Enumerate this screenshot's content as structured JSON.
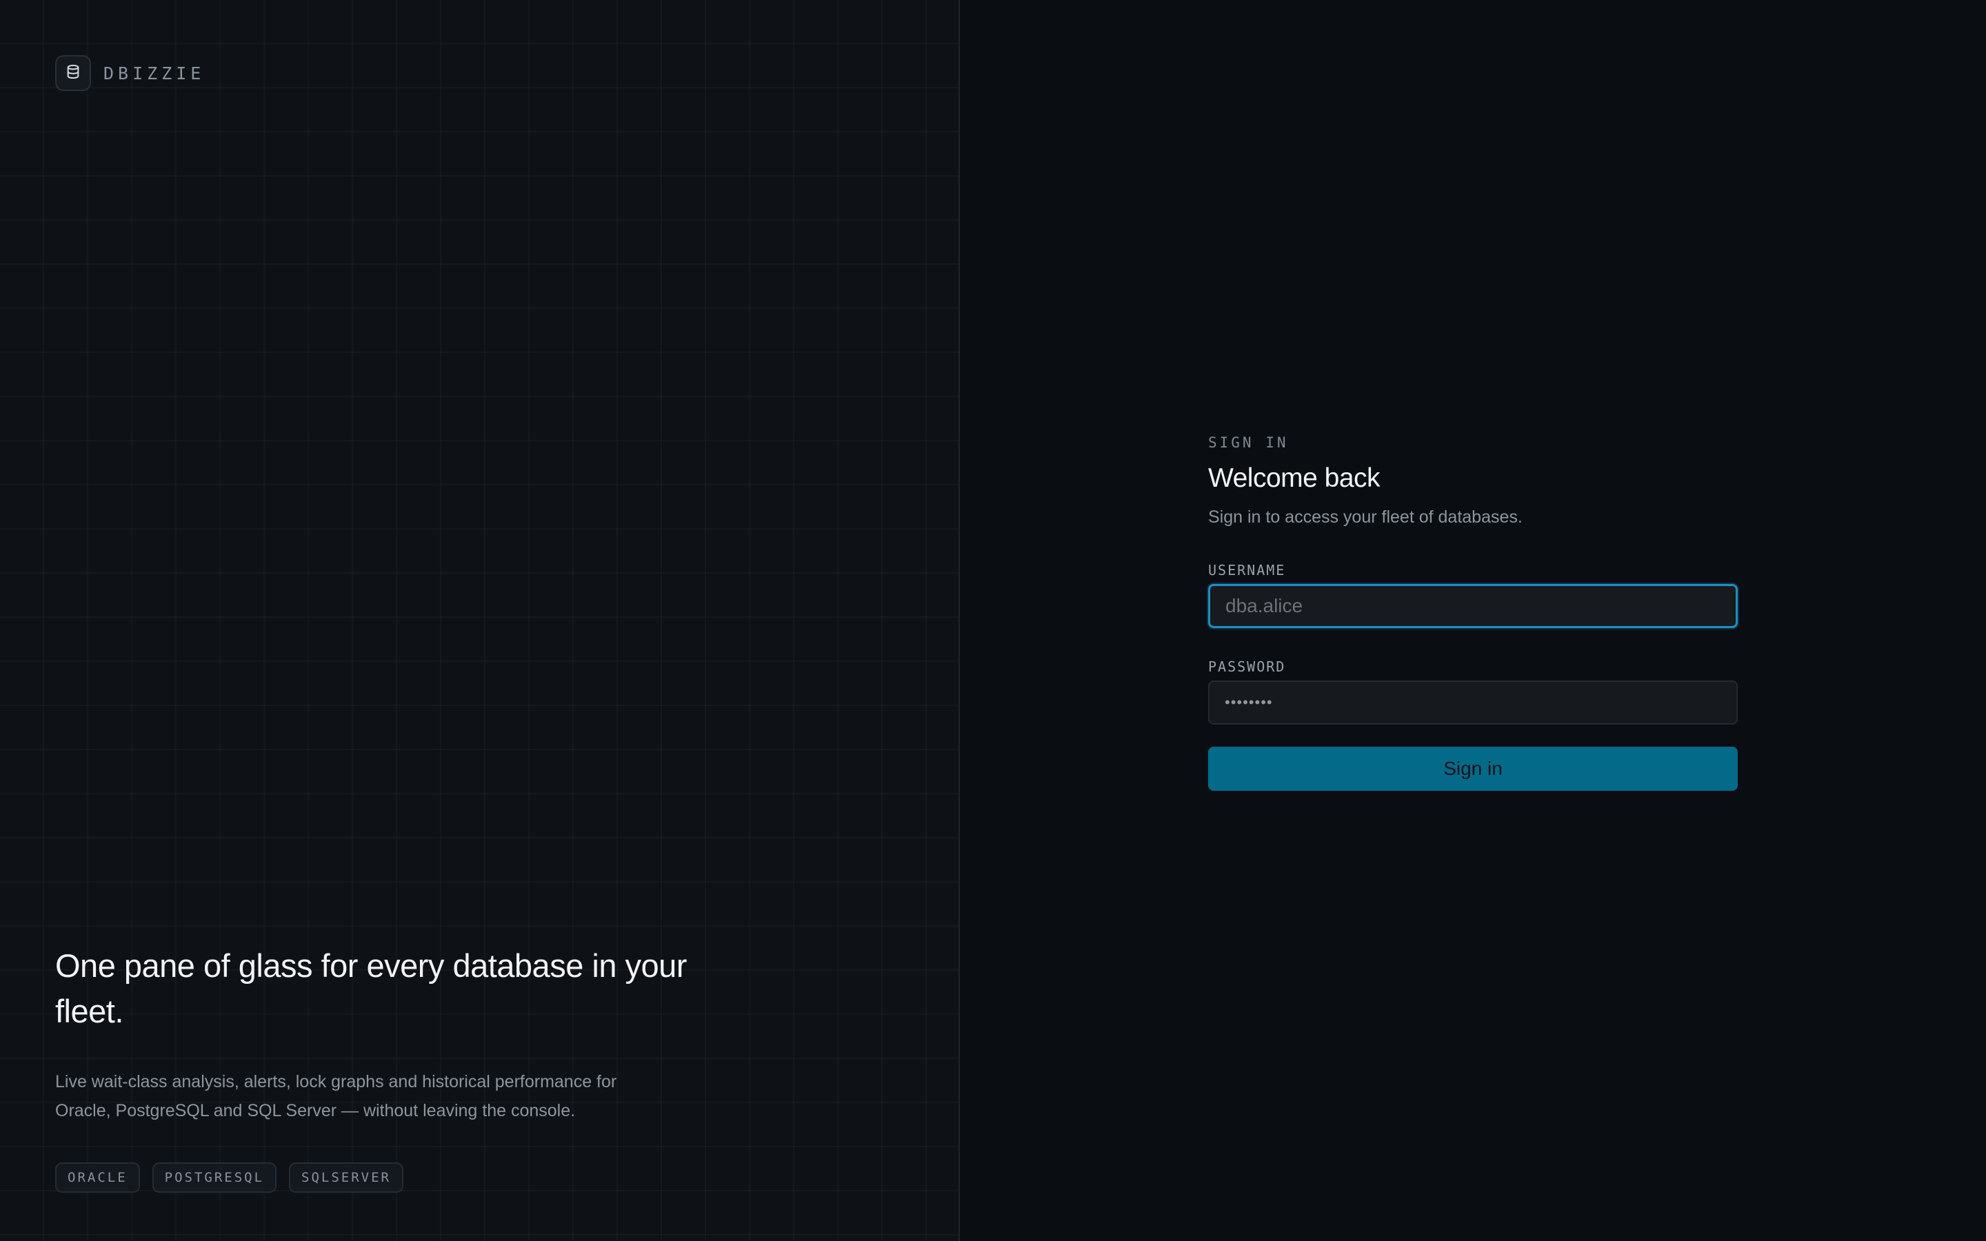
{
  "brand": {
    "name": "DBIZZIE",
    "logo_icon": "database-icon"
  },
  "hero": {
    "title": "One pane of glass for every database in your fleet.",
    "description": "Live wait-class analysis, alerts, lock graphs and historical performance for Oracle, PostgreSQL and SQL Server — without leaving the console.",
    "tags": [
      "ORACLE",
      "POSTGRESQL",
      "SQLSERVER"
    ]
  },
  "signin": {
    "eyebrow": "SIGN IN",
    "title": "Welcome back",
    "subtitle": "Sign in to access your fleet of databases.",
    "username_label": "USERNAME",
    "username_placeholder": "dba.alice",
    "username_value": "",
    "password_label": "PASSWORD",
    "password_value": "••••••••",
    "button_label": "Sign in"
  },
  "colors": {
    "accent": "#046a8a",
    "focus_ring": "#1a8fc4",
    "left_bg": "#0e1217",
    "right_bg": "#0a0e12"
  }
}
